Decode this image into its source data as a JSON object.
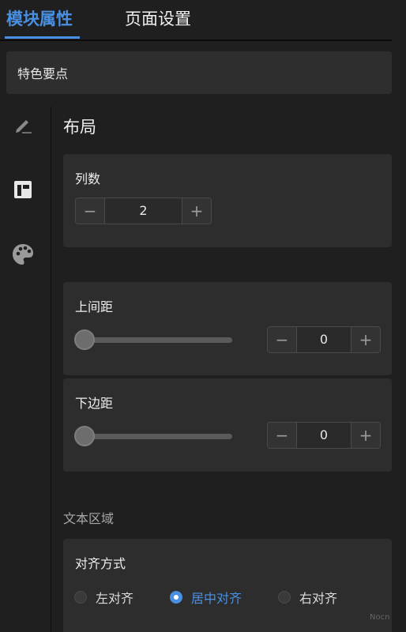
{
  "tabs": [
    {
      "label": "模块属性",
      "active": true
    },
    {
      "label": "页面设置",
      "active": false
    }
  ],
  "section_title": "特色要点",
  "rail": [
    "pen-icon",
    "layout-icon",
    "palette-icon"
  ],
  "layout": {
    "heading": "布局",
    "columns": {
      "label": "列数",
      "value": "2",
      "minus": "−",
      "plus": "+"
    },
    "top_margin": {
      "label": "上间距",
      "value": "0",
      "slider_value": 0,
      "minus": "−",
      "plus": "+"
    },
    "bottom_margin": {
      "label": "下边距",
      "value": "0",
      "slider_value": 0,
      "minus": "−",
      "plus": "+"
    }
  },
  "text_area": {
    "heading": "文本区域",
    "align": {
      "label": "对齐方式",
      "options": [
        {
          "label": "左对齐",
          "checked": false
        },
        {
          "label": "居中对齐",
          "checked": true
        },
        {
          "label": "右对齐",
          "checked": false
        }
      ]
    }
  },
  "watermark": "Nocn",
  "colors": {
    "accent": "#4a90e2",
    "background": "#1f1f1f",
    "card": "#2d2d2d"
  }
}
